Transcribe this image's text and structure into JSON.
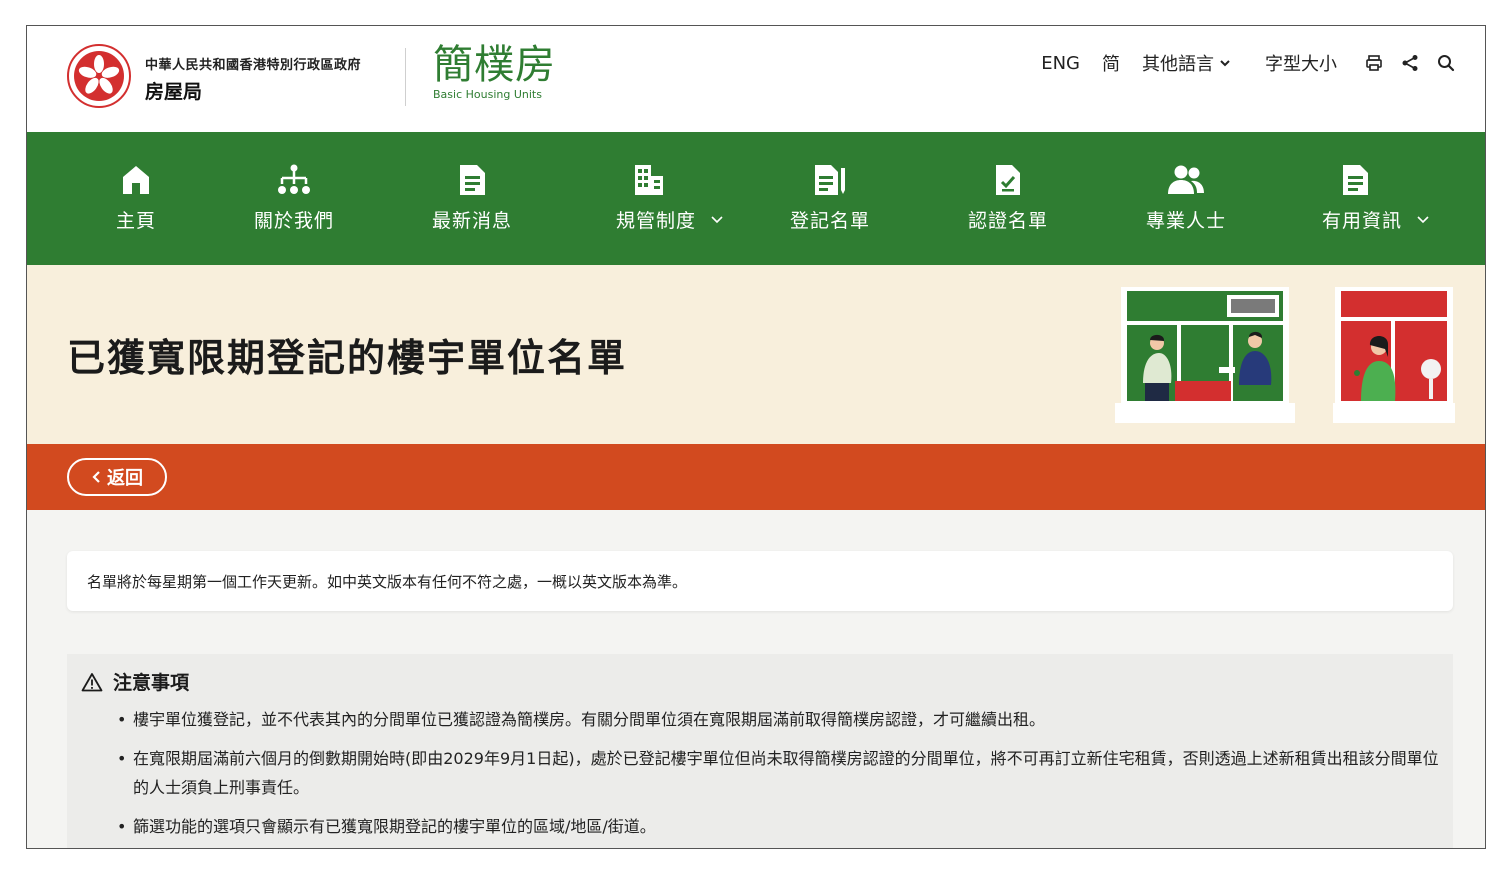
{
  "header": {
    "gov_line1": "中華人民共和國香港特別行政區政府",
    "gov_line2": "房屋局",
    "brand_name": "簡樸房",
    "brand_sub": "Basic Housing Units",
    "utils": {
      "eng": "ENG",
      "simplified": "简",
      "other_lang": "其他語言",
      "font_size": "字型大小"
    },
    "icons": [
      "print-icon",
      "share-icon",
      "search-icon"
    ]
  },
  "nav": {
    "items": [
      {
        "label": "主頁",
        "icon": "home-icon",
        "has_dropdown": false
      },
      {
        "label": "關於我們",
        "icon": "org-chart-icon",
        "has_dropdown": false
      },
      {
        "label": "最新消息",
        "icon": "document-icon",
        "has_dropdown": false
      },
      {
        "label": "規管制度",
        "icon": "building-icon",
        "has_dropdown": true
      },
      {
        "label": "登記名單",
        "icon": "register-list-icon",
        "has_dropdown": false
      },
      {
        "label": "認證名單",
        "icon": "certified-list-icon",
        "has_dropdown": false
      },
      {
        "label": "專業人士",
        "icon": "people-icon",
        "has_dropdown": false
      },
      {
        "label": "有用資訊",
        "icon": "info-document-icon",
        "has_dropdown": true
      }
    ]
  },
  "hero": {
    "title": "已獲寬限期登記的樓宇單位名單"
  },
  "back_button": {
    "label": "返回"
  },
  "notice": {
    "text": "名單將於每星期第一個工作天更新。如中英文版本有任何不符之處，一概以英文版本為準。"
  },
  "caution": {
    "title": "注意事項",
    "items": [
      "樓宇單位獲登記，並不代表其內的分間單位已獲認證為簡樸房。有關分間單位須在寬限期屆滿前取得簡樸房認證，才可繼續出租。",
      "在寬限期屆滿前六個月的倒數期開始時(即由2029年9月1日起)，處於已登記樓宇單位但尚未取得簡樸房認證的分間單位，將不可再訂立新住宅租賃，否則透過上述新租賃出租該分間單位的人士須負上刑事責任。",
      "篩選功能的選項只會顯示有已獲寬限期登記的樓宇單位的區域/地區/街道。"
    ]
  },
  "colors": {
    "nav_green": "#2f7d32",
    "hero_cream": "#f8efdc",
    "red_bar": "#d24a1f",
    "content_bg": "#f4f4f2"
  }
}
